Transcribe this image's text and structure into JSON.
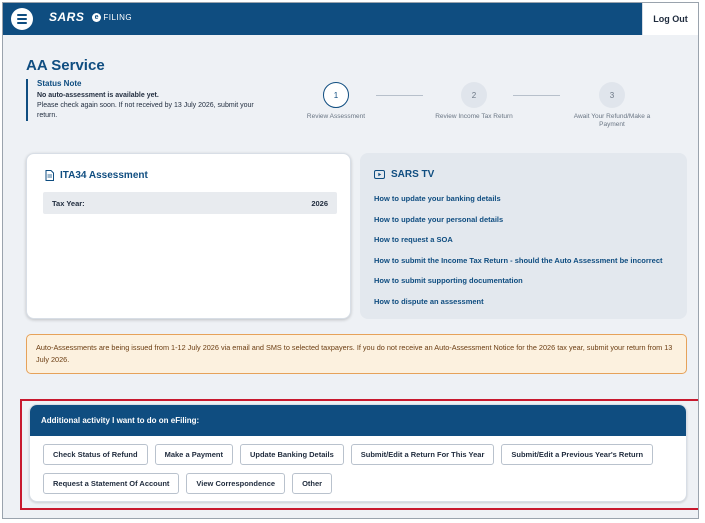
{
  "header": {
    "logo_text": "SARS",
    "efiling_text": "FILING",
    "efiling_badge": "e",
    "logout_label": "Log Out"
  },
  "page": {
    "title": "AA Service"
  },
  "status_note": {
    "title": "Status Note",
    "subtitle": "No auto-assessment is available yet.",
    "body": "Please check again soon. If not received by 13 July 2026, submit your return."
  },
  "stepper": {
    "steps": [
      {
        "number": "1",
        "label": "Review Assessment",
        "active": true
      },
      {
        "number": "2",
        "label": "Review Income Tax Return",
        "active": false
      },
      {
        "number": "3",
        "label": "Await Your Refund/Make a Payment",
        "active": false
      }
    ]
  },
  "ita34": {
    "title": "ITA34 Assessment",
    "tax_year_label": "Tax Year:",
    "tax_year_value": "2026"
  },
  "sars_tv": {
    "title": "SARS TV",
    "links": [
      "How to update your banking details",
      "How to update your personal details",
      "How to request a SOA",
      "How to submit the Income Tax Return - should the Auto Assessment be incorrect",
      "How to submit supporting documentation",
      "How to dispute an assessment"
    ]
  },
  "notice": {
    "text": "Auto-Assessments are being issued from 1-12 July 2026 via email and SMS to selected taxpayers. If you do not receive an Auto-Assessment Notice for the 2026 tax year, submit your return from 13 July 2026."
  },
  "activity": {
    "title": "Additional activity I want to do on eFiling:",
    "buttons_row1": [
      "Check Status of Refund",
      "Make a Payment",
      "Update Banking Details",
      "Submit/Edit a Return For This Year",
      "Submit/Edit a Previous Year's Return"
    ],
    "buttons_row2": [
      "Request a Statement Of Account",
      "View Correspondence",
      "Other"
    ]
  },
  "colors": {
    "brand": "#0f4d80",
    "notice_bg": "#fcf1df",
    "notice_border": "#e6a25a",
    "highlight": "#c8192e"
  }
}
